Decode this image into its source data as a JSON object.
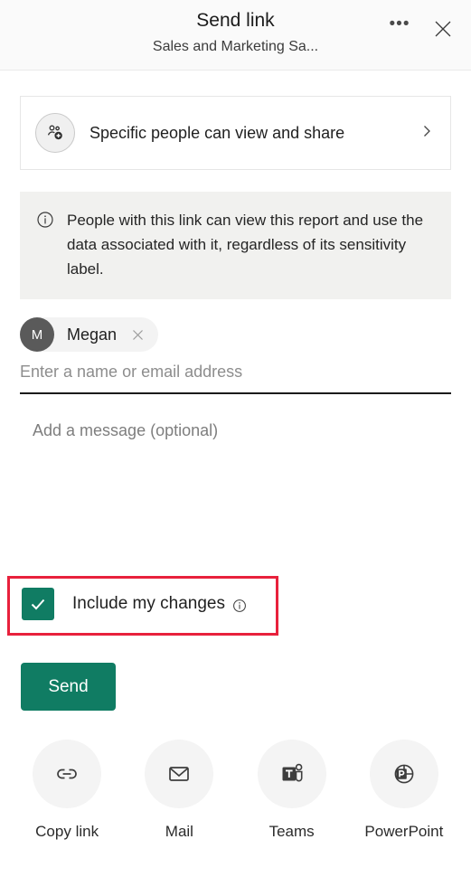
{
  "header": {
    "title": "Send link",
    "subtitle": "Sales and Marketing Sa...",
    "more_options_label": "•••",
    "more_options_name": "more-options",
    "close_name": "close"
  },
  "permission": {
    "label": "Specific people can view and share",
    "icon": "people-add-icon",
    "chevron": "chevron-right-icon"
  },
  "info_banner": {
    "icon": "info-icon",
    "text": "People with this link can view this report and use the data associated with it, regardless of its sensitivity label."
  },
  "recipients": {
    "chips": [
      {
        "initial": "M",
        "name": "Megan",
        "remove_icon": "close-icon"
      }
    ],
    "input_value": "",
    "input_placeholder": "Enter a name or email address"
  },
  "message": {
    "value": "",
    "placeholder": "Add a message (optional)"
  },
  "include_changes": {
    "label": "Include my changes",
    "checked": true,
    "info_icon": "info-icon",
    "highlight_color": "#e8213c"
  },
  "send": {
    "label": "Send"
  },
  "actions": [
    {
      "label": "Copy link",
      "icon": "link-icon"
    },
    {
      "label": "Mail",
      "icon": "mail-icon"
    },
    {
      "label": "Teams",
      "icon": "teams-icon"
    },
    {
      "label": "PowerPoint",
      "icon": "powerpoint-icon"
    }
  ],
  "colors": {
    "accent": "#107c63",
    "highlight": "#e8213c",
    "header_bg": "#fafafa",
    "banner_bg": "#f1f1ef",
    "avatar_bg": "#5a5a5a"
  }
}
